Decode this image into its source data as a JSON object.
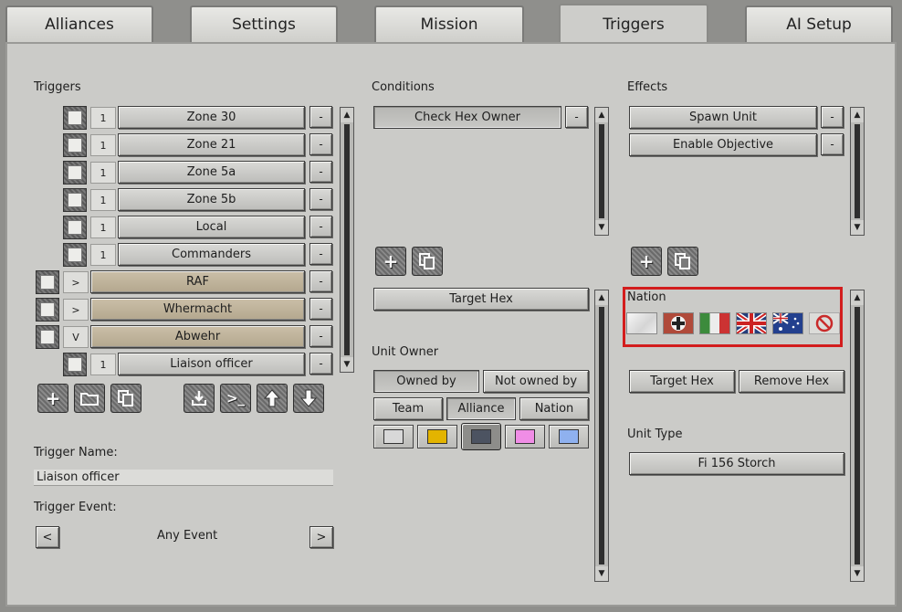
{
  "tabs": [
    {
      "label": "Alliances"
    },
    {
      "label": "Settings"
    },
    {
      "label": "Mission"
    },
    {
      "label": "Triggers"
    },
    {
      "label": "AI Setup"
    }
  ],
  "triggers": {
    "heading": "Triggers",
    "rows": [
      {
        "label": "Zone 30",
        "marker": "1"
      },
      {
        "label": "Zone 21",
        "marker": "1"
      },
      {
        "label": "Zone 5a",
        "marker": "1"
      },
      {
        "label": "Zone 5b",
        "marker": "1"
      },
      {
        "label": "Local",
        "marker": "1"
      },
      {
        "label": "Commanders",
        "marker": "1"
      },
      {
        "label": "RAF",
        "marker": ">"
      },
      {
        "label": "Whermacht",
        "marker": ">"
      },
      {
        "label": "Abwehr",
        "marker": "V"
      },
      {
        "label": "Liaison officer",
        "marker": "1"
      }
    ],
    "remove_label": "-",
    "toolbar_icons": [
      "plus-icon",
      "folder-icon",
      "copy-icon",
      "import-icon",
      "console-icon",
      "arrow-up-icon",
      "arrow-down-icon"
    ]
  },
  "trigger_name": {
    "label": "Trigger Name:",
    "value": "Liaison officer"
  },
  "trigger_event": {
    "label": "Trigger Event:",
    "value": "Any Event",
    "prev": "<",
    "next": ">"
  },
  "conditions": {
    "heading": "Conditions",
    "items": [
      {
        "label": "Check Hex Owner"
      }
    ],
    "target_hex": "Target Hex",
    "unit_owner_label": "Unit Owner",
    "owned_by": "Owned by",
    "not_owned_by": "Not owned by",
    "team": "Team",
    "alliance": "Alliance",
    "nation": "Nation",
    "swatch_colors": [
      "#d8d8d8",
      "#e3b400",
      "#4c5361",
      "#f08de6",
      "#8fb1ef"
    ]
  },
  "effects": {
    "heading": "Effects",
    "items": [
      {
        "label": "Spawn Unit"
      },
      {
        "label": "Enable Objective"
      }
    ],
    "nation_label": "Nation",
    "flags": [
      "flag-white-icon",
      "flag-germany-icon",
      "flag-italy-icon",
      "flag-uk-icon",
      "flag-australia-icon",
      "no-nation-icon"
    ],
    "target_hex": "Target Hex",
    "remove_hex": "Remove Hex",
    "unit_type_label": "Unit Type",
    "unit_type_value": "Fi 156 Storch"
  },
  "colors": {
    "highlight": "#d31d1d",
    "tan": "#c0b399"
  }
}
